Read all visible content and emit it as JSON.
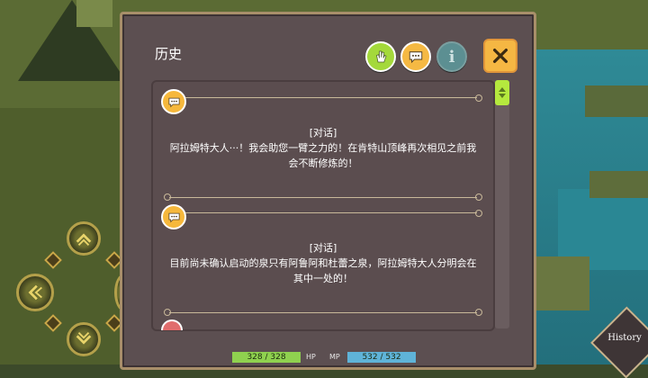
{
  "panel": {
    "title": "历史",
    "buttons": [
      {
        "name": "hand-button",
        "icon": "hand-icon",
        "color": "#a4d93b"
      },
      {
        "name": "dialogue-filter-button",
        "icon": "speech-bubble-icon",
        "color": "#f5b943"
      },
      {
        "name": "info-button",
        "icon": "info-icon",
        "color": "#5c8f92",
        "glyph": "i"
      }
    ],
    "close": {
      "icon": "close-icon",
      "color": "#f5b743"
    }
  },
  "entries": [
    {
      "type": "dialogue",
      "icon": "speech-bubble-icon",
      "header": "[对话]",
      "line1": "阿拉姆特大人···！我会助您一臂之力的！在肯特山顶峰再次相见之前我",
      "line2": "会不断修炼的！"
    },
    {
      "type": "dialogue",
      "icon": "speech-bubble-icon",
      "header": "[对话]",
      "line1": "目前尚未确认启动的泉只有阿鲁阿和杜蕾之泉，阿拉姆特大人分明会在",
      "line2": "其中一处的！"
    }
  ],
  "hud": {
    "hp_value": "328 / 328",
    "hp_label": "HP",
    "mp_label": "MP",
    "mp_value": "532 / 532",
    "hp_color": "#8fd14f",
    "mp_color": "#5fb3d8",
    "history_label": "History"
  },
  "colors": {
    "panel_bg": "#5c4f51",
    "panel_border": "#a88f6a",
    "accent": "#f5b743",
    "scroll": "#b5e93e"
  }
}
